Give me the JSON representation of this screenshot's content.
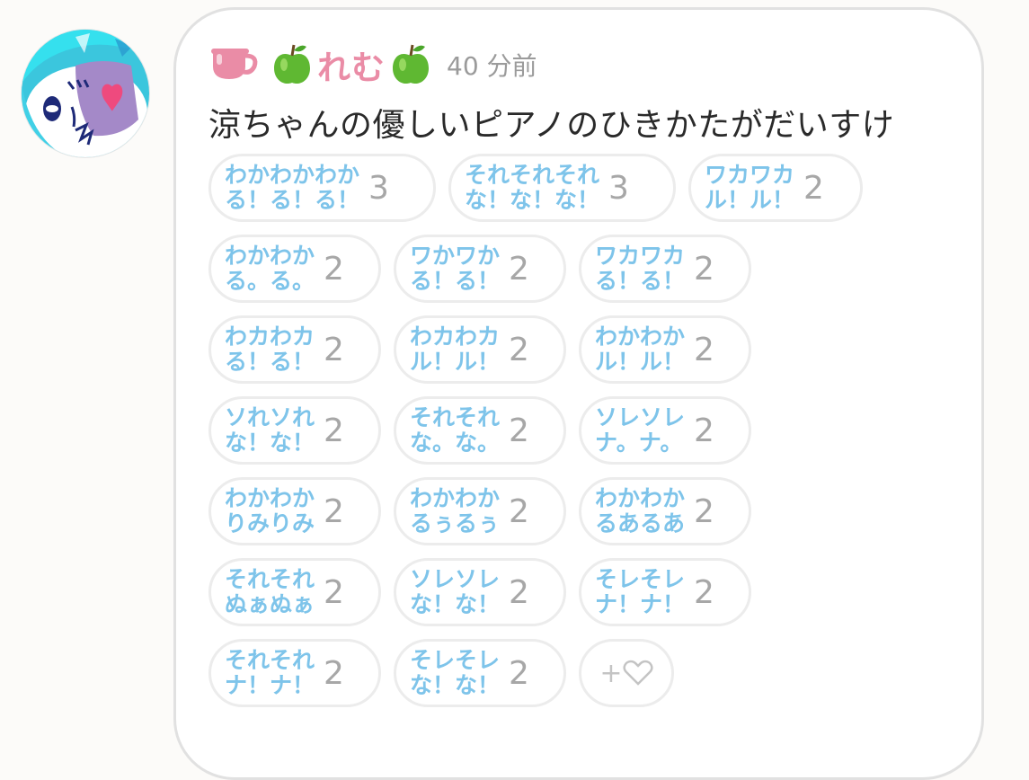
{
  "colors": {
    "accent_name": "#ea8ca6",
    "reaction_text": "#7ec4ea",
    "count_text": "#a7a7a7",
    "timestamp": "#9b9b9b"
  },
  "post": {
    "author": "れむ",
    "badge_icon": "teacup-icon",
    "emoji_icon": "green-apple-icon",
    "timestamp": "40 分前",
    "message": "涼ちゃんの優しいピアノのひきかたがだいすけ"
  },
  "reactions": [
    [
      {
        "l1": "わかわかわか",
        "l2": "る！る！る！",
        "count": "3"
      },
      {
        "l1": "それそれそれ",
        "l2": "な！な！な！",
        "count": "3"
      },
      {
        "l1": "ワカワカ",
        "l2": "ル！ル！",
        "count": "2"
      }
    ],
    [
      {
        "l1": "わかわか",
        "l2": "る。る。",
        "count": "2"
      },
      {
        "l1": "ワかワか",
        "l2": "る！る！",
        "count": "2"
      },
      {
        "l1": "ワカワカ",
        "l2": "る！る！",
        "count": "2"
      }
    ],
    [
      {
        "l1": "わカわカ",
        "l2": "る！る！",
        "count": "2"
      },
      {
        "l1": "わカわカ",
        "l2": "ル！ル！",
        "count": "2"
      },
      {
        "l1": "わかわか",
        "l2": "ル！ル！",
        "count": "2"
      }
    ],
    [
      {
        "l1": "ソれソれ",
        "l2": "な！な！",
        "count": "2"
      },
      {
        "l1": "それそれ",
        "l2": "な。な。",
        "count": "2"
      },
      {
        "l1": "ソレソレ",
        "l2": "ナ。ナ。",
        "count": "2"
      }
    ],
    [
      {
        "l1": "わかわか",
        "l2": "りみりみ",
        "count": "2"
      },
      {
        "l1": "わかわか",
        "l2": "るぅるぅ",
        "count": "2"
      },
      {
        "l1": "わかわか",
        "l2": "るあるあ",
        "count": "2"
      }
    ],
    [
      {
        "l1": "それそれ",
        "l2": "ぬぁぬぁ",
        "count": "2"
      },
      {
        "l1": "ソレソレ",
        "l2": "な！な！",
        "count": "2"
      },
      {
        "l1": "そレそレ",
        "l2": "ナ！ナ！",
        "count": "2"
      }
    ],
    [
      {
        "l1": "それそれ",
        "l2": "ナ！ナ！",
        "count": "2"
      },
      {
        "l1": "そレそレ",
        "l2": "な！な！",
        "count": "2"
      }
    ]
  ],
  "add_reaction": {
    "plus": "+",
    "icon": "heart-outline-icon"
  }
}
